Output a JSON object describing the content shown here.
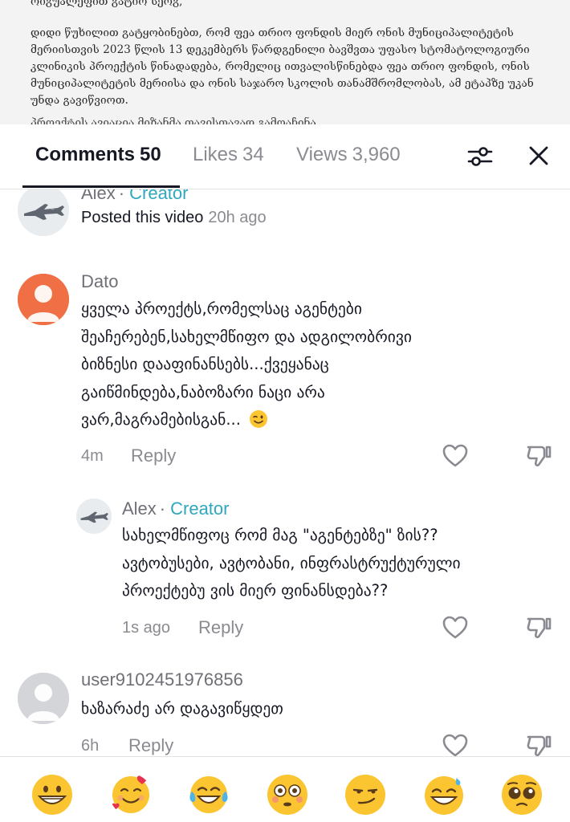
{
  "document": {
    "line_top": "ოიგუალეფით გატიო სეოგ,",
    "paragraph": "დიდი წუხილით გატყობინებთ, რომ ფეა თრიო ფონდის მიერ ონის მუნიციპალიტეტის მერიისთვის 2023 წლის 13 დეკემბერს წარდგენილი ბავშვთა უფასო სტომატოლოგიური კლინიკის პროექტის წინადადება, რომელიც ითვალისწინებდა ფეა თრიო ფონდის, ონის მუნიციპალიტეტის მერიისა და ონის საჯარო სკოლის თანამშრომლობას, ამ ეტაპზე უკან უნდა გავიწვიოთ.",
    "line_bottom": "პროექტის ავიაცია მიზანმა თავისთავად გამოაჩინა"
  },
  "tabs": [
    {
      "label": "Comments",
      "count": "50"
    },
    {
      "label": "Likes",
      "count": "34"
    },
    {
      "label": "Views",
      "count": "3,960"
    }
  ],
  "icons": {
    "filter": "sliders-icon",
    "close": "close-icon",
    "like": "heart-outline-icon",
    "dislike": "thumbs-down-icon"
  },
  "colors": {
    "creator_accent": "#2fa7bd",
    "text_primary": "#161823",
    "text_secondary": "#8a8b91"
  },
  "comments": [
    {
      "author": "Alex",
      "badge": "Creator",
      "posted_label": "Posted this video",
      "time": "20h ago"
    },
    {
      "author": "Dato",
      "lines": [
        "ყველა პროექტს,რომელსაც აგენტები",
        "შეაჩერებენ,სახელმწიფო და ადგილობრივი",
        "ბიზნესი დააფინანსებს...ქვეყანაც",
        "გაიწმინდება,ნაბოზარი ნაცი არა",
        "ვარ,მაგრამებისგან..."
      ],
      "time": "4m",
      "reply": "Reply"
    },
    {
      "author": "Alex",
      "badge": "Creator",
      "lines": [
        "სახელმწიფოც რომ მაგ \"აგენტებზე\" ზის??",
        "ავტობუსები, ავტობანი, ინფრასტრუქტურული",
        "პროექტებუ ვის მიერ ფინანსდება??"
      ],
      "time": "1s ago",
      "reply": "Reply"
    },
    {
      "author": "user9102451976856",
      "lines": [
        "ხაზარაძე არ დაგავიწყდეთ"
      ],
      "time": "6h",
      "reply": "Reply"
    }
  ],
  "emojis": [
    "grinning-face",
    "smiling-face-with-hearts",
    "face-with-tears-of-joy",
    "flushed-face",
    "smirking-face",
    "grinning-face-with-sweat",
    "pleading-face"
  ]
}
